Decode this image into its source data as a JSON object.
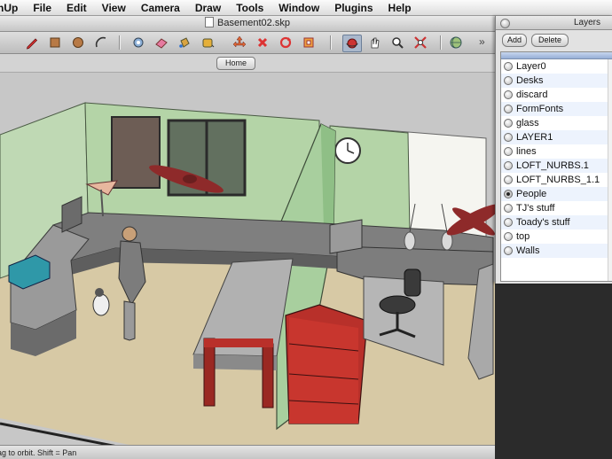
{
  "menubar": {
    "items": [
      "nUp",
      "File",
      "Edit",
      "View",
      "Camera",
      "Draw",
      "Tools",
      "Window",
      "Plugins",
      "Help"
    ]
  },
  "window": {
    "title": "Basement02.skp"
  },
  "toolbar": {
    "icons": [
      "pencil-icon",
      "rectangle-icon",
      "circle-icon",
      "arc-icon",
      "push-pull-icon",
      "eraser-icon",
      "paint-bucket-icon",
      "tape-measure-icon",
      "move-icon",
      "rotate-icon",
      "scale-icon",
      "offset-icon",
      "orbit-icon",
      "pan-icon",
      "zoom-icon",
      "zoom-extents-icon",
      "globe-icon"
    ],
    "overflow": "»"
  },
  "scenes": {
    "home_label": "Home"
  },
  "status": {
    "text": "ag to orbit.  Shift = Pan"
  },
  "layers_panel": {
    "title": "Layers",
    "add_label": "Add",
    "delete_label": "Delete",
    "active_layer": "People",
    "layers": [
      "Layer0",
      "Desks",
      "discard",
      "FormFonts",
      "glass",
      "LAYER1",
      "lines",
      "LOFT_NURBS.1",
      "LOFT_NURBS_1.1",
      "People",
      "TJ's stuff",
      "Toady's stuff",
      "top",
      "Walls"
    ]
  },
  "colors": {
    "wall_green": "#b5d6a9",
    "floor_tan": "#d6c9a6",
    "desk_gray": "#9c9c9c",
    "cabinet_red": "#b9302a",
    "selection_blue": "#9db5dc"
  }
}
